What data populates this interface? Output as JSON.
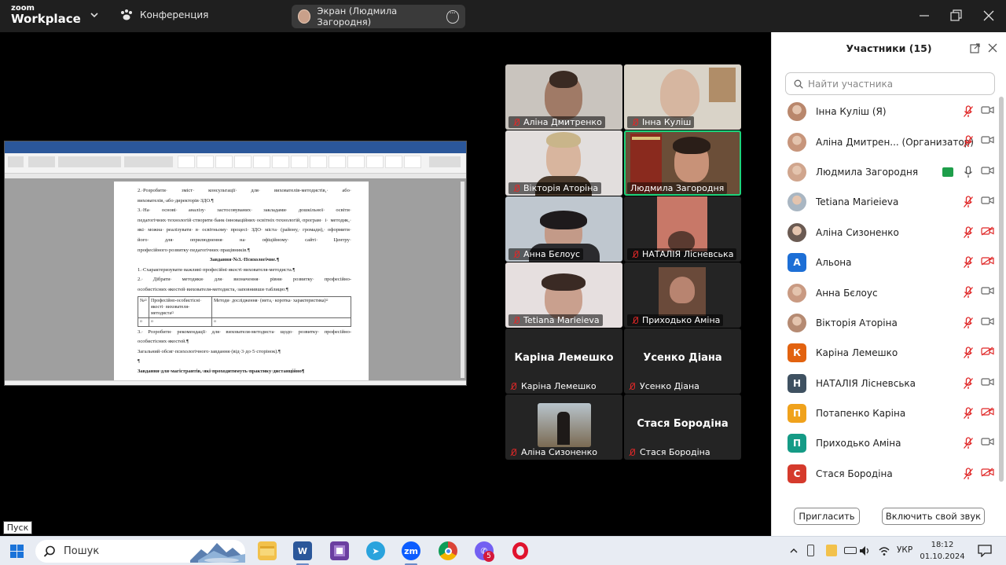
{
  "titlebar": {
    "logo_top": "zoom",
    "logo_bottom": "Workplace",
    "meeting_label": "Конференция",
    "screen_share_label": "Экран (Людмила Загородня)"
  },
  "shared_document": {
    "p1": "2.·Розробити· зміст· консультації· для· вихователів-методистів,· або· вихователів,·або·директорів·ЗДО.¶",
    "p2": "3.·На· основі· аналізу· застосовуваних· закладами· дошкільної· освіти· педагогічних·технологій·створити·банк·інноваційних·освітніх·технологій,·програм· і· методик,· які· можна· реалізувати· в· освітньому· процесі· ЗДО· міста· (району,· громади),· оформити· його· для· оприлюднення· на· офіційному· сайті· Центру· професійного·розвитку·педагогічних·працівників.¶",
    "heading": "Завдання·№3.·Психологічне.¶",
    "p3": "1.·Схарактеризувати·важливі·професійні·якості·вихователя-методиста.¶",
    "p4": "2.· Дібрати· методики· для· визначення· рівня· розвитку· професійно-особистісних·якостей·вихователя-методиста,·заповнивши·таблицю:¶",
    "table_headers": [
      "№¤",
      "Професійно-особистісні· якості· вихователя-методиста¤",
      "Методи· дослідження· (мета,· коротка· характеристика)¤"
    ],
    "table_row": [
      "¤",
      "¤",
      "¤"
    ],
    "p5": "3.· Розробити· рекомендації· для· вихователя-методиста· щодо· розвитку· професійно-особистісних·якостей.¶",
    "p6": "Загальний·обсяг·психологічного·завдання·(від·3·до·5·сторінок).¶",
    "p7": "¶",
    "p8": "Завдання·для·магістрантів,·які·проходитимуть·практику·дистанційно¶"
  },
  "video_tiles": [
    {
      "name": "Аліна Дмитренко"
    },
    {
      "name": "Інна Куліш"
    },
    {
      "name": "Вікторія Аторіна"
    },
    {
      "name": "Людмила Загородня"
    },
    {
      "name": "Анна Бєлоус"
    },
    {
      "name": "НАТАЛІЯ Лісневська"
    },
    {
      "name": "Tetiana Marieieva"
    },
    {
      "name": "Приходько Аміна"
    },
    {
      "name": "Каріна Лемешко",
      "big": "Каріна Лемешко"
    },
    {
      "name": "Усенко Діана",
      "big": "Усенко Діана"
    },
    {
      "name": "Аліна Сизоненко"
    },
    {
      "name": "Стася Бородіна",
      "big": "Стася Бородіна"
    }
  ],
  "participants_panel": {
    "title": "Участники (15)",
    "search_placeholder": "Найти участника",
    "items": [
      {
        "name": "Інна Куліш (Я)",
        "avatar": "photo",
        "mic": "muted",
        "cam": "on"
      },
      {
        "name": "Аліна Дмитрен...  (Организатор)",
        "avatar": "photo",
        "mic": "muted",
        "cam": "on"
      },
      {
        "name": "Людмила Загородня",
        "avatar": "photo",
        "mic": "on",
        "cam": "on",
        "sharing": true
      },
      {
        "name": "Tetiana Marieieva",
        "avatar": "photo",
        "mic": "muted",
        "cam": "on"
      },
      {
        "name": "Аліна Сизоненко",
        "avatar": "photo",
        "mic": "muted",
        "cam": "off"
      },
      {
        "name": "Альона",
        "avatar": "А",
        "avatar_color": "#1d6fd6",
        "mic": "muted",
        "cam": "off"
      },
      {
        "name": "Анна Бєлоус",
        "avatar": "photo",
        "mic": "muted",
        "cam": "on"
      },
      {
        "name": "Вікторія Аторіна",
        "avatar": "photo",
        "mic": "muted",
        "cam": "on"
      },
      {
        "name": "Каріна Лемешко",
        "avatar": "К",
        "avatar_color": "#e2620f",
        "mic": "muted",
        "cam": "off"
      },
      {
        "name": "НАТАЛІЯ Лісневська",
        "avatar": "Н",
        "avatar_color": "#3f5161",
        "mic": "muted",
        "cam": "on"
      },
      {
        "name": "Потапенко Каріна",
        "avatar": "П",
        "avatar_color": "#f0a21c",
        "mic": "muted",
        "cam": "off"
      },
      {
        "name": "Приходько Аміна",
        "avatar": "П",
        "avatar_color": "#159b86",
        "mic": "muted",
        "cam": "on"
      },
      {
        "name": "Стася Бородіна",
        "avatar": "С",
        "avatar_color": "#d53a2c",
        "mic": "muted",
        "cam": "off"
      }
    ],
    "invite_label": "Пригласить",
    "unmute_label": "Включить свой звук"
  },
  "start_tooltip": "Пуск",
  "taskbar": {
    "search_label": "Пошук",
    "telegram_badge": "5",
    "lang": "УКР",
    "time": "18:12",
    "date": "01.10.2024"
  }
}
